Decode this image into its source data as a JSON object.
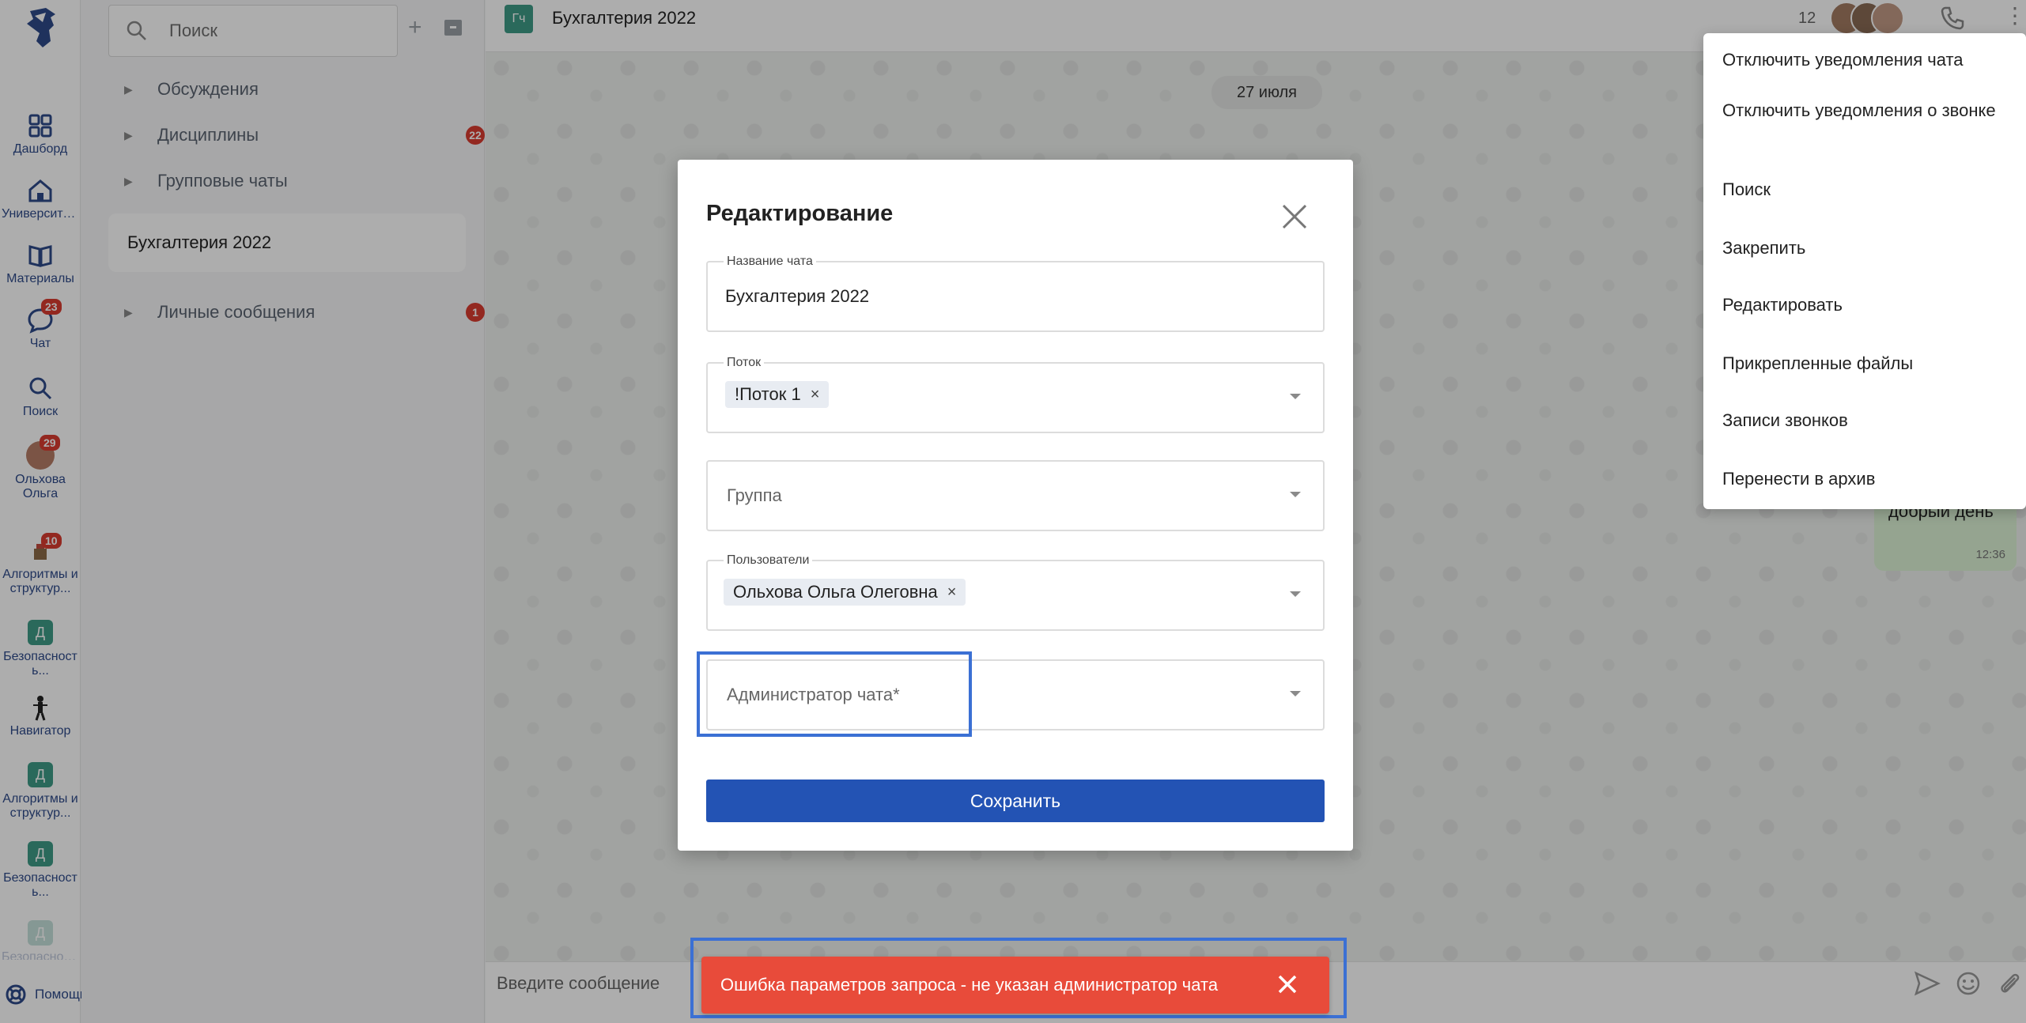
{
  "rail": {
    "items": [
      {
        "label": "Дашборд",
        "icon": "dashboard-icon"
      },
      {
        "label": "Университе...",
        "icon": "university-icon"
      },
      {
        "label": "Материалы",
        "icon": "book-icon"
      },
      {
        "label": "Чат",
        "icon": "chat-icon",
        "badge": "23"
      },
      {
        "label": "Поиск",
        "icon": "search-icon"
      },
      {
        "label": "Ольхова Ольга",
        "icon": "user-avatar",
        "badge": "29"
      },
      {
        "label": "Алгоритмы и структур...",
        "icon": "course-icon",
        "badge": "10"
      },
      {
        "label": "Безопасност ь...",
        "icon": "course-tile",
        "tile": "Д"
      },
      {
        "label": "Навигатор",
        "icon": "navigator-icon"
      },
      {
        "label": "Алгоритмы и структур...",
        "icon": "course-tile",
        "tile": "Д"
      },
      {
        "label": "Безопасност ь...",
        "icon": "course-tile",
        "tile": "Д"
      },
      {
        "label": "Безопасност ь...",
        "icon": "course-tile",
        "tile": "Д"
      }
    ],
    "help_label": "Помощь"
  },
  "chat_list": {
    "search_placeholder": "Поиск",
    "groups": [
      {
        "label": "Обсуждения",
        "badge": ""
      },
      {
        "label": "Дисциплины",
        "badge": "22"
      },
      {
        "label": "Групповые чаты",
        "badge": ""
      },
      {
        "label": "Личные сообщения",
        "badge": "1"
      }
    ],
    "selected_chat": "Бухгалтерия 2022"
  },
  "chat": {
    "avatar_initials": "Гч",
    "title": "Бухгалтерия 2022",
    "member_count": "12",
    "date_divider": "27 июля",
    "last_message": {
      "text": "добрый день",
      "time": "12:36"
    },
    "composer_placeholder": "Введите сообщение"
  },
  "context_menu": {
    "items": [
      "Отключить уведомления чата",
      "Отключить уведомления о звонке",
      "Поиск",
      "Закрепить",
      "Редактировать",
      "Прикрепленные файлы",
      "Записи звонков",
      "Перенести в архив"
    ]
  },
  "modal": {
    "title": "Редактирование",
    "chat_name": {
      "label": "Название чата",
      "value": "Бухгалтерия 2022"
    },
    "stream": {
      "label": "Поток",
      "chips": [
        "!Поток 1"
      ]
    },
    "group": {
      "placeholder": "Группа"
    },
    "users": {
      "label": "Пользователи",
      "chips": [
        "Ольхова Ольга Олеговна"
      ]
    },
    "admin": {
      "placeholder": "Администратор чата*"
    },
    "save_label": "Сохранить"
  },
  "toast": {
    "message": "Ошибка параметров запроса - не указан администратор чата"
  },
  "colors": {
    "primary": "#2353b4",
    "error": "#e84b3a",
    "highlight": "#3b70d4",
    "badge": "#d93b30",
    "tile": "#3e9b87"
  }
}
